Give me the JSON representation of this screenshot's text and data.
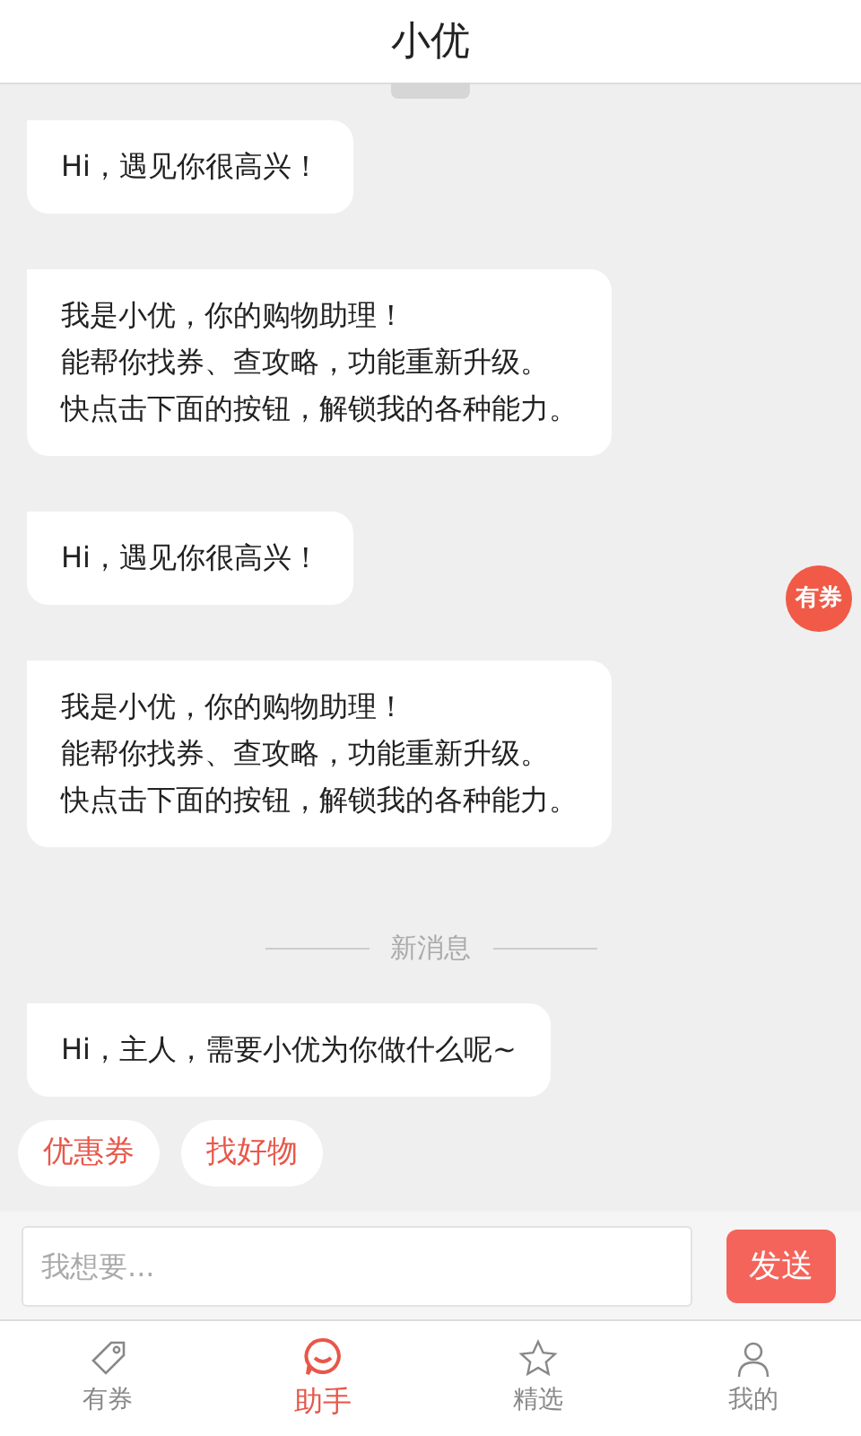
{
  "header": {
    "title": "小优"
  },
  "messages": [
    {
      "kind": "bubble",
      "lines": [
        "Hi，遇见你很高兴！"
      ]
    },
    {
      "kind": "bubble",
      "lines": [
        "我是小优，你的购物助理！",
        "能帮你找券、查攻略，功能重新升级。",
        "快点击下面的按钮，解锁我的各种能力。"
      ]
    },
    {
      "kind": "bubble",
      "lines": [
        "Hi，遇见你很高兴！"
      ]
    },
    {
      "kind": "bubble",
      "lines": [
        "我是小优，你的购物助理！",
        "能帮你找券、查攻略，功能重新升级。",
        "快点击下面的按钮，解锁我的各种能力。"
      ]
    },
    {
      "kind": "divider",
      "lines": [
        "新消息"
      ]
    },
    {
      "kind": "bubble",
      "lines": [
        "Hi，主人，需要小优为你做什么呢~"
      ]
    }
  ],
  "quick_replies": [
    "优惠券",
    "找好物"
  ],
  "floating_badge": "有券",
  "input": {
    "placeholder": "我想要...",
    "send": "发送"
  },
  "tabs": [
    {
      "label": "有券",
      "selected": false
    },
    {
      "label": "助手",
      "selected": true
    },
    {
      "label": "精选",
      "selected": false
    },
    {
      "label": "我的",
      "selected": false
    }
  ]
}
